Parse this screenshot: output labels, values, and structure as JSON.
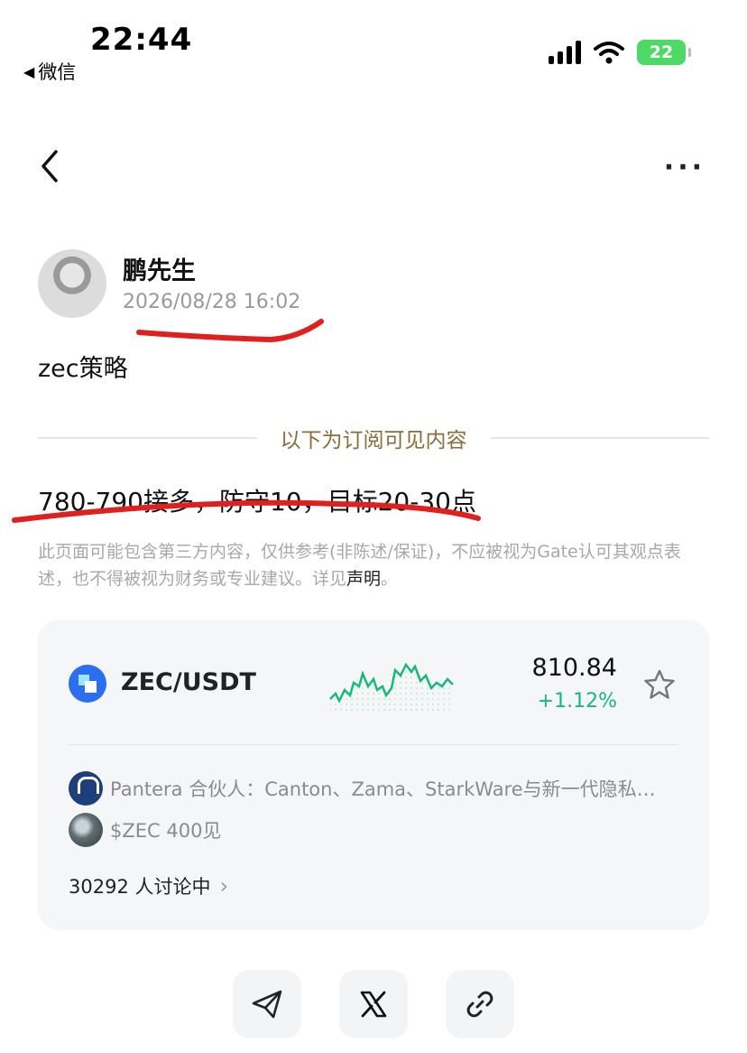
{
  "status_bar": {
    "time": "22:44",
    "back_app": "微信",
    "battery": "22"
  },
  "nav": {
    "back_icon": "chevron-left-icon",
    "more_icon": "more-horizontal-icon"
  },
  "post": {
    "author": "鹏先生",
    "timestamp": "2026/08/28 16:02",
    "title": "zec策略",
    "subscription_divider": "以下为订阅可见内容",
    "strategy_text": "780-790接多，防守10，目标20-30点",
    "disclaimer": "此页面可能包含第三方内容，仅供参考(非陈述/保证)，不应被视为Gate认可其观点表述，也不得被视为财务或专业建议。详见",
    "disclaimer_link": "声明",
    "disclaimer_end": "。"
  },
  "market_card": {
    "pair": "ZEC/USDT",
    "price": "810.84",
    "change": "+1.12%",
    "colors": {
      "up": "#16b979",
      "brand": "#2b6ff0"
    },
    "news": [
      {
        "text": "Pantera 合伙人：Canton、Zama、StarkWare与新一代隐私…",
        "icon": "panews-logo-icon"
      },
      {
        "text": "$ZEC 400见",
        "icon": "user-avatar-icon"
      }
    ],
    "discussion": "30292 人讨论中"
  },
  "share": {
    "buttons": [
      "telegram-icon",
      "x-icon",
      "link-icon"
    ]
  }
}
